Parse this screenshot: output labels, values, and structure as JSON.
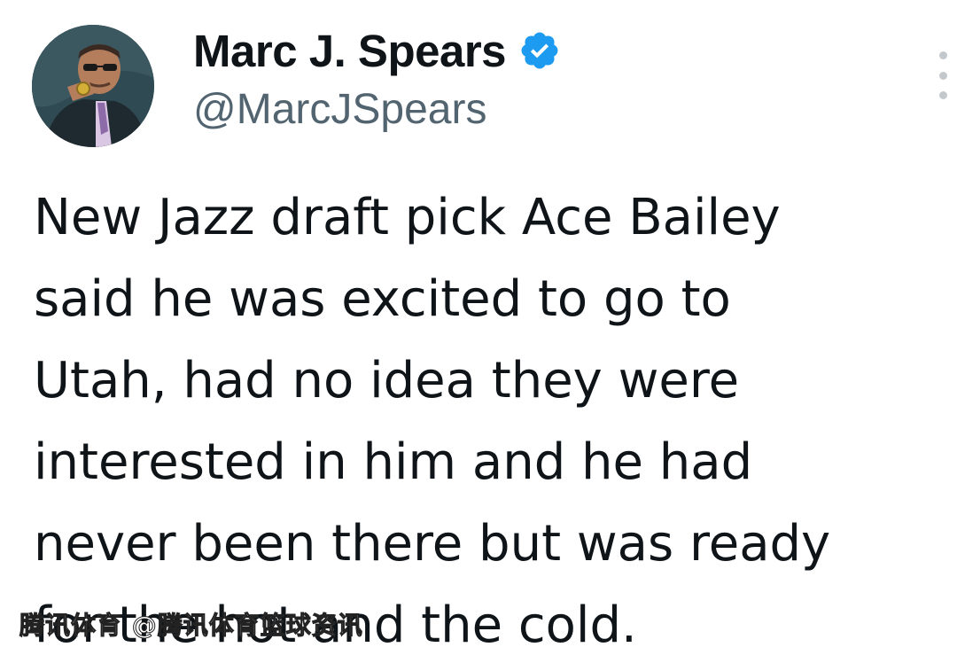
{
  "author": {
    "display_name": "Marc J. Spears",
    "handle": "@MarcJSpears",
    "verified": true
  },
  "tweet": {
    "lines": [
      "New Jazz draft pick Ace Bailey",
      "said he was excited to go to",
      "Utah, had no idea they were",
      "interested in him and he had",
      "never been there but was ready",
      "for the hot and the cold."
    ]
  },
  "watermark": {
    "text": "腾讯体育 @腾讯体育篮球资讯"
  },
  "icons": {
    "verified": "verified-badge-icon",
    "more": "more-dots-icon"
  },
  "colors": {
    "verified_blue": "#1d9bf0",
    "handle_gray": "#536471",
    "text": "#0f1419"
  }
}
